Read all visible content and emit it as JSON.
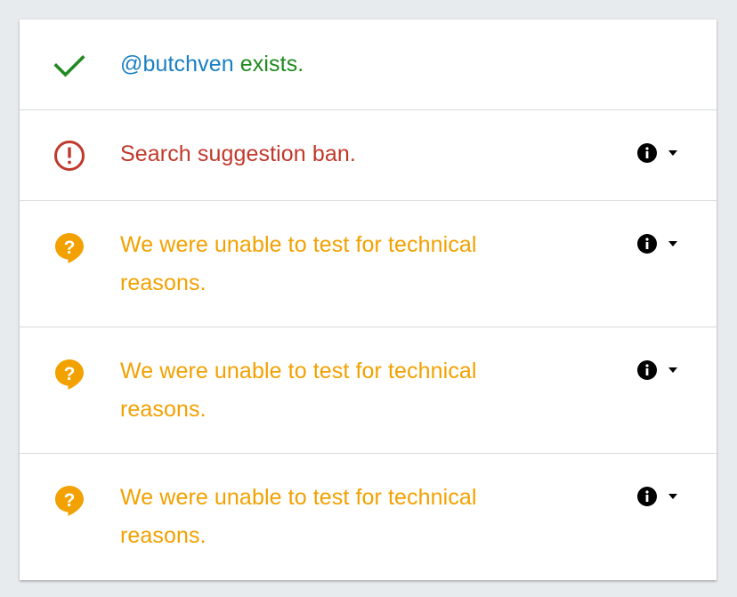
{
  "rows": [
    {
      "status": "ok",
      "icon": "checkmark-icon",
      "handle": "@butchven",
      "message": " exists.",
      "color": "#20891f"
    },
    {
      "status": "ban",
      "icon": "exclamation-circle-icon",
      "message": "Search suggestion ban.",
      "color": "#c0392b",
      "controls": [
        "info-icon",
        "caret-down-icon"
      ]
    },
    {
      "status": "unknown",
      "icon": "question-bubble-icon",
      "message": "We were unable to test for technical reasons.",
      "color": "#f2a100",
      "controls": [
        "info-icon",
        "caret-down-icon"
      ]
    },
    {
      "status": "unknown",
      "icon": "question-bubble-icon",
      "message": "We were unable to test for technical reasons.",
      "color": "#f2a100",
      "controls": [
        "info-icon",
        "caret-down-icon"
      ]
    },
    {
      "status": "unknown",
      "icon": "question-bubble-icon",
      "message": "We were unable to test for technical reasons.",
      "color": "#f2a100",
      "controls": [
        "info-icon",
        "caret-down-icon"
      ]
    }
  ],
  "colors": {
    "handle": "#1a7fc1",
    "background": "#e8ebee",
    "card": "#ffffff"
  }
}
